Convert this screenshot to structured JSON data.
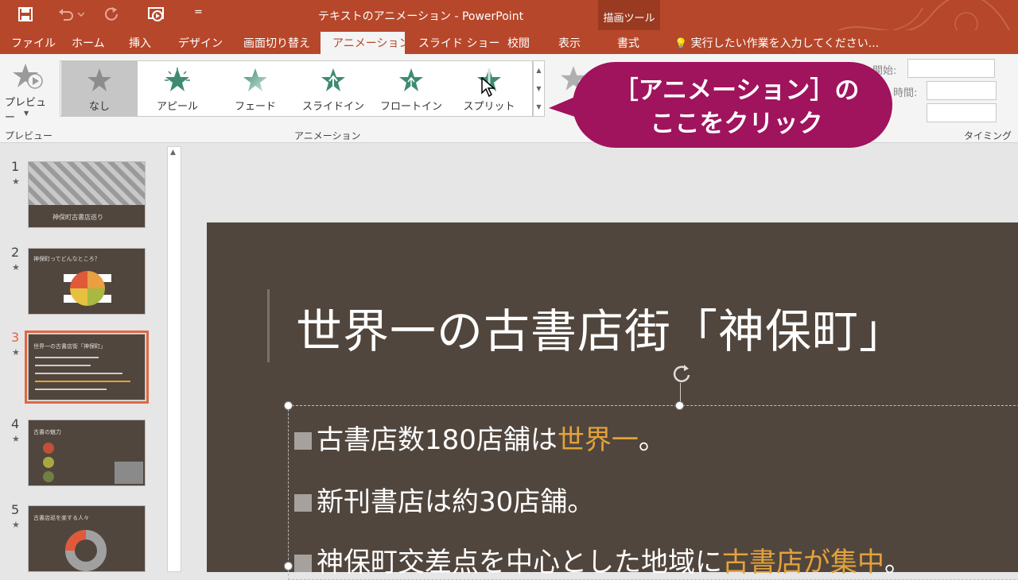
{
  "window": {
    "title": "テキストのアニメーション - PowerPoint",
    "context_group": "描画ツール",
    "customize_glyph": "="
  },
  "ribbon_tabs": [
    "ファイル",
    "ホーム",
    "挿入",
    "デザイン",
    "画面切り替え",
    "アニメーション",
    "スライド ショー",
    "校閲",
    "表示",
    "書式"
  ],
  "active_tab": "アニメーション",
  "tell_me": "実行したい作業を入力してください...",
  "preview": {
    "button_label": "プレビュー",
    "group_label": "プレビュー"
  },
  "gallery": {
    "items": [
      "なし",
      "アピール",
      "フェード",
      "スライドイン",
      "フロートイン",
      "スプリット"
    ],
    "selected": "なし",
    "group_label": "アニメーション"
  },
  "timing": {
    "start_label": "開始:",
    "duration_label": "時間:",
    "group_label": "タイミング"
  },
  "callout": {
    "line1": "［アニメーション］の",
    "line2": "ここをクリック"
  },
  "thumbnails": [
    {
      "number": "1",
      "star": "★",
      "caption": "神保町古書店巡り"
    },
    {
      "number": "2",
      "star": "★",
      "caption": "神保町ってどんなところ？"
    },
    {
      "number": "3",
      "star": "★",
      "caption": "世界一の古書店街「神保町」"
    },
    {
      "number": "4",
      "star": "★",
      "caption": "古書の魅力"
    },
    {
      "number": "5",
      "star": "★",
      "caption": "古書店巡を楽する人々"
    }
  ],
  "slide": {
    "title": "世界一の古書店街「神保町」",
    "bullets": [
      {
        "before": "古書店数180店舗は",
        "highlight": "世界一",
        "after": "。"
      },
      {
        "before": "新刊書店は約30店舗。",
        "highlight": "",
        "after": ""
      },
      {
        "before": "神保町交差点を中心とした地域に",
        "highlight": "古書店が集中",
        "after": "。"
      }
    ]
  },
  "colors": {
    "accent": "#b7472a",
    "slide_bg": "#51463d",
    "highlight": "#e3a23b",
    "callout": "#a0135d",
    "selected_thumb": "#e0673f"
  }
}
